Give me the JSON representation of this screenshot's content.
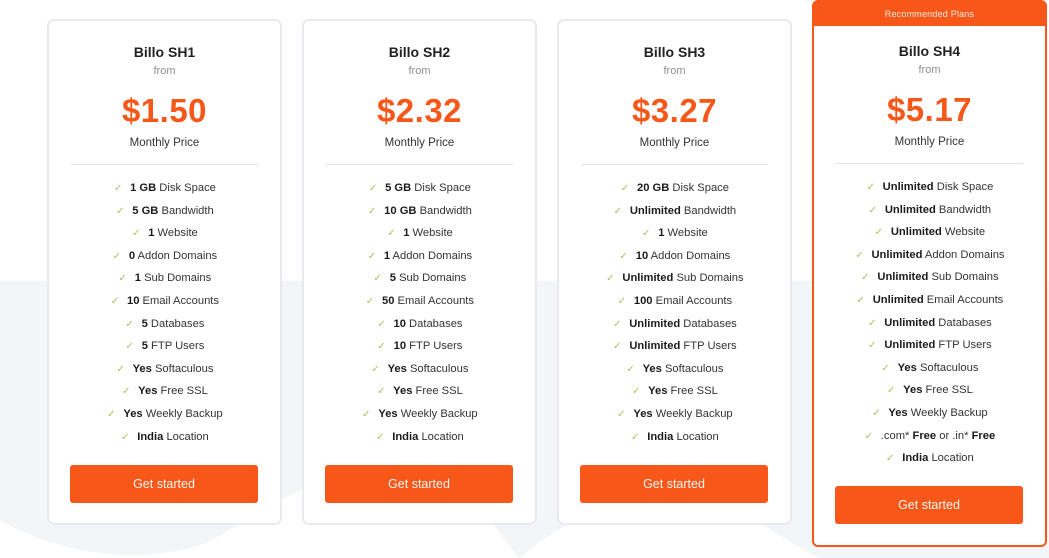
{
  "recommended_label": "Recommended Plans",
  "colors": {
    "accent": "#f7581a",
    "check": "#a6c15b",
    "card_border": "#e9eaef",
    "background_wave": "#f3f6f9"
  },
  "plans": [
    {
      "name": "Billo SH1",
      "from": "from",
      "price": "$1.50",
      "period": "Monthly Price",
      "cta": "Get started",
      "recommended": false,
      "features": [
        {
          "bold": "1 GB",
          "text": " Disk Space"
        },
        {
          "bold": "5 GB",
          "text": " Bandwidth"
        },
        {
          "bold": "1",
          "text": " Website"
        },
        {
          "bold": "0",
          "text": " Addon Domains"
        },
        {
          "bold": "1",
          "text": " Sub Domains"
        },
        {
          "bold": "10",
          "text": " Email Accounts"
        },
        {
          "bold": "5",
          "text": " Databases"
        },
        {
          "bold": "5",
          "text": " FTP Users"
        },
        {
          "bold": "Yes",
          "text": " Softaculous"
        },
        {
          "bold": "Yes",
          "text": " Free SSL"
        },
        {
          "bold": "Yes",
          "text": " Weekly Backup"
        },
        {
          "bold": "India",
          "text": " Location"
        }
      ]
    },
    {
      "name": "Billo SH2",
      "from": "from",
      "price": "$2.32",
      "period": "Monthly Price",
      "cta": "Get started",
      "recommended": false,
      "features": [
        {
          "bold": "5 GB",
          "text": " Disk Space"
        },
        {
          "bold": "10 GB",
          "text": " Bandwidth"
        },
        {
          "bold": "1",
          "text": " Website"
        },
        {
          "bold": "1",
          "text": " Addon Domains"
        },
        {
          "bold": "5",
          "text": " Sub Domains"
        },
        {
          "bold": "50",
          "text": " Email Accounts"
        },
        {
          "bold": "10",
          "text": " Databases"
        },
        {
          "bold": "10",
          "text": " FTP Users"
        },
        {
          "bold": "Yes",
          "text": " Softaculous"
        },
        {
          "bold": "Yes",
          "text": " Free SSL"
        },
        {
          "bold": "Yes",
          "text": " Weekly Backup"
        },
        {
          "bold": "India",
          "text": " Location"
        }
      ]
    },
    {
      "name": "Billo SH3",
      "from": "from",
      "price": "$3.27",
      "period": "Monthly Price",
      "cta": "Get started",
      "recommended": false,
      "features": [
        {
          "bold": "20 GB",
          "text": " Disk Space"
        },
        {
          "bold": "Unlimited",
          "text": " Bandwidth"
        },
        {
          "bold": "1",
          "text": " Website"
        },
        {
          "bold": "10",
          "text": " Addon Domains"
        },
        {
          "bold": "Unlimited",
          "text": " Sub Domains"
        },
        {
          "bold": "100",
          "text": " Email Accounts"
        },
        {
          "bold": "Unlimited",
          "text": " Databases"
        },
        {
          "bold": "Unlimited",
          "text": " FTP Users"
        },
        {
          "bold": "Yes",
          "text": " Softaculous"
        },
        {
          "bold": "Yes",
          "text": " Free SSL"
        },
        {
          "bold": "Yes",
          "text": " Weekly Backup"
        },
        {
          "bold": "India",
          "text": " Location"
        }
      ]
    },
    {
      "name": "Billo SH4",
      "from": "from",
      "price": "$5.17",
      "period": "Monthly Price",
      "cta": "Get started",
      "recommended": true,
      "features": [
        {
          "bold": "Unlimited",
          "text": " Disk Space"
        },
        {
          "bold": "Unlimited",
          "text": " Bandwidth"
        },
        {
          "bold": "Unlimited",
          "text": " Website"
        },
        {
          "bold": "Unlimited",
          "text": " Addon Domains"
        },
        {
          "bold": "Unlimited",
          "text": " Sub Domains"
        },
        {
          "bold": "Unlimited",
          "text": " Email Accounts"
        },
        {
          "bold": "Unlimited",
          "text": " Databases"
        },
        {
          "bold": "Unlimited",
          "text": " FTP Users"
        },
        {
          "bold": "Yes",
          "text": " Softaculous"
        },
        {
          "bold": "Yes",
          "text": " Free SSL"
        },
        {
          "bold": "Yes",
          "text": " Weekly Backup"
        },
        {
          "parts": [
            {
              "t": ".com* ",
              "b": false
            },
            {
              "t": "Free",
              "b": true
            },
            {
              "t": " or .in* ",
              "b": false
            },
            {
              "t": "Free",
              "b": true
            }
          ]
        },
        {
          "bold": "India",
          "text": " Location"
        }
      ]
    }
  ]
}
